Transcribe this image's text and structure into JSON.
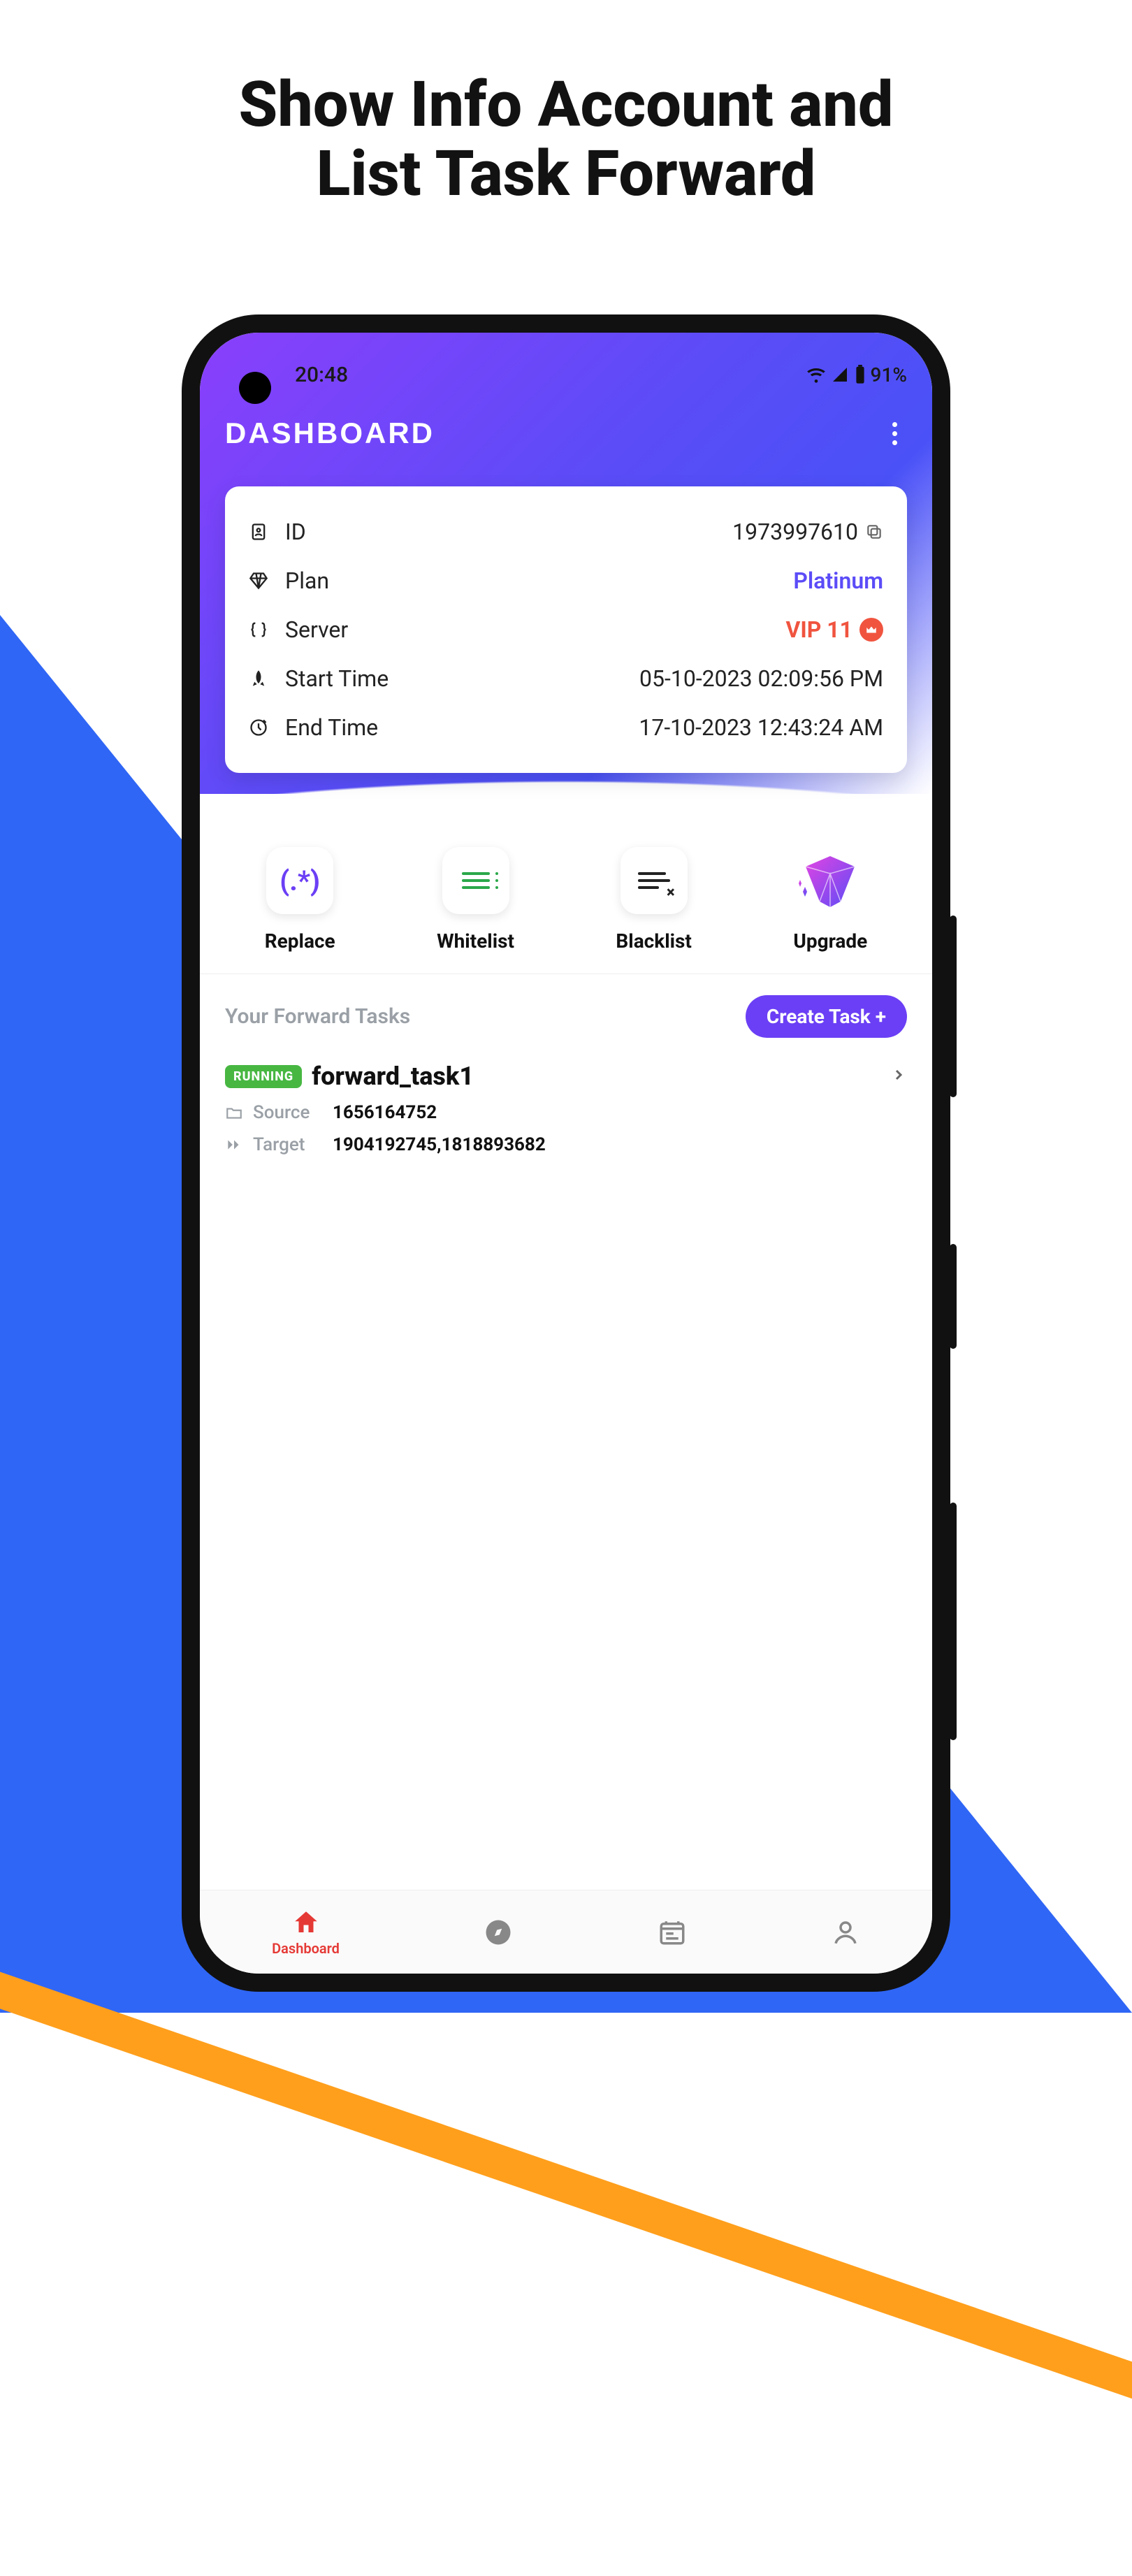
{
  "promo_title_line1": "Show Info Account and",
  "promo_title_line2": "List Task Forward",
  "status": {
    "time": "20:48",
    "battery": "91%"
  },
  "header": {
    "title": "DASHBOARD"
  },
  "info": {
    "id_label": "ID",
    "id_value": "1973997610",
    "plan_label": "Plan",
    "plan_value": "Platinum",
    "server_label": "Server",
    "server_value": "VIP 11",
    "start_label": "Start Time",
    "start_value": "05-10-2023 02:09:56 PM",
    "end_label": "End Time",
    "end_value": "17-10-2023 12:43:24 AM"
  },
  "actions": {
    "replace": "Replace",
    "whitelist": "Whitelist",
    "blacklist": "Blacklist",
    "upgrade": "Upgrade"
  },
  "tasks": {
    "heading": "Your Forward Tasks",
    "create_label": "Create Task +",
    "items": [
      {
        "status": "RUNNING",
        "name": "forward_task1",
        "source_label": "Source",
        "source_value": "1656164752",
        "target_label": "Target",
        "target_value": "1904192745,1818893682"
      }
    ]
  },
  "bottom_nav": {
    "dashboard": "Dashboard"
  }
}
